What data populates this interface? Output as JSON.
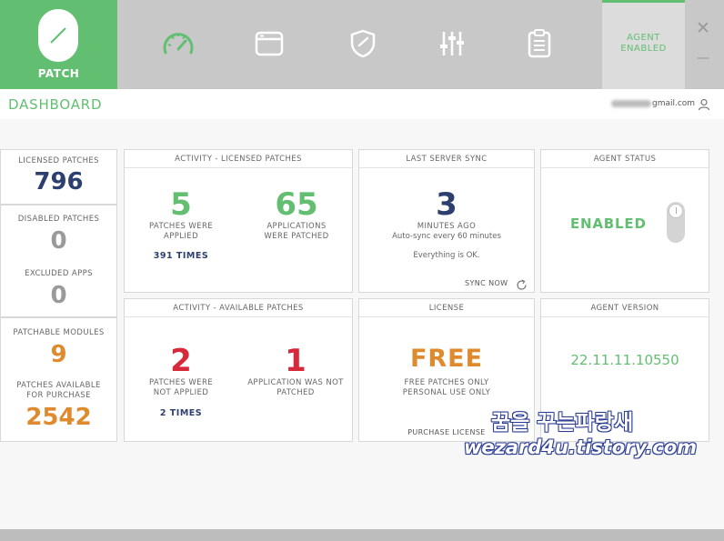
{
  "header": {
    "logo_label": "PATCH",
    "nav": [
      {
        "name": "dashboard",
        "icon": "speedometer-icon",
        "active": true
      },
      {
        "name": "applications",
        "icon": "window-icon"
      },
      {
        "name": "security",
        "icon": "shield-icon"
      },
      {
        "name": "settings",
        "icon": "sliders-icon"
      },
      {
        "name": "reports",
        "icon": "clipboard-icon"
      }
    ],
    "agent_line1": "AGENT",
    "agent_line2": "ENABLED",
    "close": "✕",
    "minimize": "—"
  },
  "subheader": {
    "title": "DASHBOARD",
    "email_suffix": "gmail.com"
  },
  "left": {
    "licensed_label": "LICENSED PATCHES",
    "licensed_value": "796",
    "disabled_label": "DISABLED PATCHES",
    "disabled_value": "0",
    "excluded_label": "EXCLUDED APPS",
    "excluded_value": "0",
    "modules_label": "PATCHABLE MODULES",
    "modules_value": "9",
    "purchase_label1": "PATCHES AVAILABLE",
    "purchase_label2": "FOR PURCHASE",
    "purchase_value": "2542"
  },
  "activity_licensed": {
    "title": "ACTIVITY - LICENSED PATCHES",
    "left_value": "5",
    "left_label1": "PATCHES WERE",
    "left_label2": "APPLIED",
    "times": "391 TIMES",
    "right_value": "65",
    "right_label1": "APPLICATIONS",
    "right_label2": "WERE PATCHED"
  },
  "last_sync": {
    "title": "LAST SERVER SYNC",
    "value": "3",
    "label": "MINUTES AGO",
    "auto": "Auto-sync every 60 minutes",
    "status": "Everything is OK.",
    "sync_now": "SYNC NOW"
  },
  "agent_status": {
    "title": "AGENT STATUS",
    "value": "ENABLED"
  },
  "activity_available": {
    "title": "ACTIVITY - AVAILABLE PATCHES",
    "left_value": "2",
    "left_label1": "PATCHES WERE",
    "left_label2": "NOT APPLIED",
    "times": "2 TIMES",
    "right_value": "1",
    "right_label1": "APPLICATION WAS NOT",
    "right_label2": "PATCHED"
  },
  "license": {
    "title": "LICENSE",
    "value": "FREE",
    "label1": "FREE PATCHES ONLY",
    "label2": "PERSONAL USE ONLY",
    "purchase": "PURCHASE LICENSE"
  },
  "agent_version": {
    "title": "AGENT VERSION",
    "value": "22.11.11.10550"
  },
  "watermark": {
    "ko": "꿈을 꾸는파랑새",
    "en": "wezard4u.tistory.com"
  },
  "colors": {
    "green": "#62bf72",
    "navy": "#2d3f6e",
    "gray": "#9a9a9a",
    "orange": "#e08a2e",
    "red": "#d8283c"
  }
}
